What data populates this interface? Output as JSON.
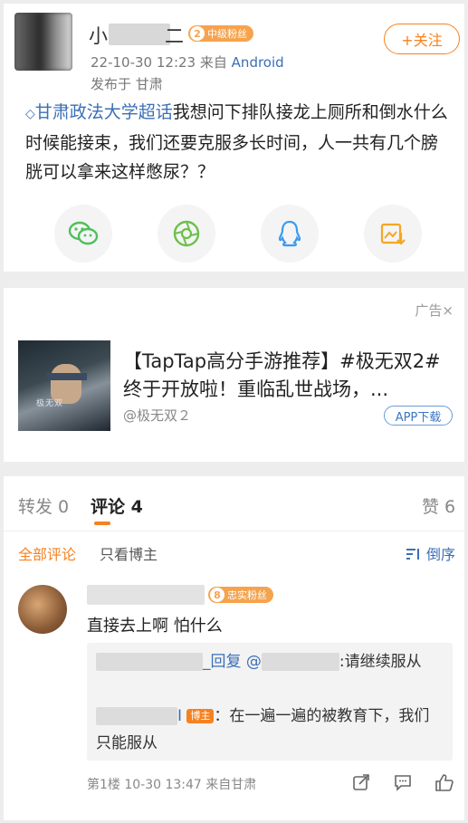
{
  "post": {
    "username_visible": "小",
    "username_tail": "二",
    "fan_badge_level": "2",
    "fan_badge_label": "中级粉丝",
    "follow_label": "+关注",
    "time": "22-10-30 12:23",
    "source_prefix": "来自",
    "source": "Android",
    "location": "发布于 甘肃",
    "topic_icon": "◇",
    "topic": "甘肃政法大学超话",
    "text": "我想问下排队接龙上厕所和倒水什么时候能接束，我们还要克服多长时间，人一共有几个膀胱可以拿来这样憋尿？？",
    "share_icons": [
      "wechat-icon",
      "moments-icon",
      "qq-icon",
      "save-image-icon"
    ]
  },
  "ad": {
    "label": "广告×",
    "title": "【TapTap高分手游推荐】#极无双2#终于开放啦！重临乱世战场，...",
    "source": "@极无双２",
    "button": "APP下载",
    "thumb_logo": "极无双"
  },
  "comments": {
    "tabs": [
      {
        "label": "转发 0"
      },
      {
        "label": "评论 4"
      },
      {
        "label": "赞 6"
      }
    ],
    "filter_all": "全部评论",
    "filter_host": "只看博主",
    "sort_label": "倒序",
    "item": {
      "badge_level": "8",
      "badge_label": "忠实粉丝",
      "text": "直接去上啊 怕什么",
      "reply1_prefix": "_回复",
      "reply1_at": "@",
      "reply1_text": ":请继续服从",
      "reply2_name_tail": "I",
      "reply2_tag": "博主",
      "reply2_text": "：在一遍一遍的被教育下，我们只能服从",
      "footer": "第1楼 10-30 13:47 来自甘肃"
    }
  },
  "colors": {
    "accent": "#f58220",
    "link": "#3b6fb6"
  }
}
